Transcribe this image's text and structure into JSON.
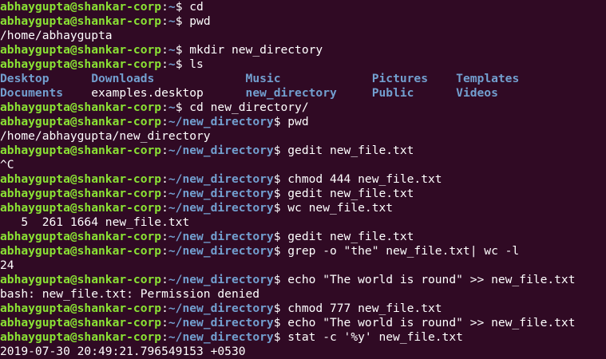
{
  "terminal": {
    "lines": [
      {
        "type": "prompt",
        "user": "abhaygupta@shankar-corp",
        "path": "~",
        "command": "cd"
      },
      {
        "type": "prompt",
        "user": "abhaygupta@shankar-corp",
        "path": "~",
        "command": "pwd"
      },
      {
        "type": "output",
        "text": "/home/abhaygupta"
      },
      {
        "type": "prompt",
        "user": "abhaygupta@shankar-corp",
        "path": "~",
        "command": "mkdir new_directory"
      },
      {
        "type": "prompt",
        "user": "abhaygupta@shankar-corp",
        "path": "~",
        "command": "ls"
      },
      {
        "type": "ls",
        "items": [
          {
            "name": "Desktop",
            "dir": true
          },
          {
            "name": "Downloads",
            "dir": true
          },
          {
            "name": "Music",
            "dir": true
          },
          {
            "name": "Pictures",
            "dir": true
          },
          {
            "name": "Templates",
            "dir": true
          }
        ]
      },
      {
        "type": "ls",
        "items": [
          {
            "name": "Documents",
            "dir": true
          },
          {
            "name": "examples.desktop",
            "dir": false
          },
          {
            "name": "new_directory",
            "dir": true
          },
          {
            "name": "Public",
            "dir": true
          },
          {
            "name": "Videos",
            "dir": true
          }
        ]
      },
      {
        "type": "prompt",
        "user": "abhaygupta@shankar-corp",
        "path": "~",
        "command": "cd new_directory/"
      },
      {
        "type": "prompt",
        "user": "abhaygupta@shankar-corp",
        "path": "~/new_directory",
        "command": "pwd"
      },
      {
        "type": "output",
        "text": "/home/abhaygupta/new_directory"
      },
      {
        "type": "prompt",
        "user": "abhaygupta@shankar-corp",
        "path": "~/new_directory",
        "command": "gedit new_file.txt"
      },
      {
        "type": "output",
        "text": "^C"
      },
      {
        "type": "prompt",
        "user": "abhaygupta@shankar-corp",
        "path": "~/new_directory",
        "command": "chmod 444 new_file.txt"
      },
      {
        "type": "prompt",
        "user": "abhaygupta@shankar-corp",
        "path": "~/new_directory",
        "command": "gedit new_file.txt"
      },
      {
        "type": "prompt",
        "user": "abhaygupta@shankar-corp",
        "path": "~/new_directory",
        "command": "wc new_file.txt"
      },
      {
        "type": "output",
        "text": "   5  261 1664 new_file.txt"
      },
      {
        "type": "prompt",
        "user": "abhaygupta@shankar-corp",
        "path": "~/new_directory",
        "command": "gedit new_file.txt"
      },
      {
        "type": "prompt",
        "user": "abhaygupta@shankar-corp",
        "path": "~/new_directory",
        "command": "grep -o \"the\" new_file.txt| wc -l"
      },
      {
        "type": "output",
        "text": "24"
      },
      {
        "type": "prompt",
        "user": "abhaygupta@shankar-corp",
        "path": "~/new_directory",
        "command": "echo \"The world is round\" >> new_file.txt"
      },
      {
        "type": "output",
        "text": "bash: new_file.txt: Permission denied"
      },
      {
        "type": "prompt",
        "user": "abhaygupta@shankar-corp",
        "path": "~/new_directory",
        "command": "chmod 777 new_file.txt"
      },
      {
        "type": "prompt",
        "user": "abhaygupta@shankar-corp",
        "path": "~/new_directory",
        "command": "echo \"The world is round\" >> new_file.txt"
      },
      {
        "type": "prompt",
        "user": "abhaygupta@shankar-corp",
        "path": "~/new_directory",
        "command": "stat -c '%y' new_file.txt"
      },
      {
        "type": "output",
        "text": "2019-07-30 20:49:21.796549153 +0530"
      }
    ],
    "colors": {
      "background": "#300a24",
      "user": "#8ae234",
      "path": "#729fcf",
      "text": "#ffffff"
    }
  }
}
